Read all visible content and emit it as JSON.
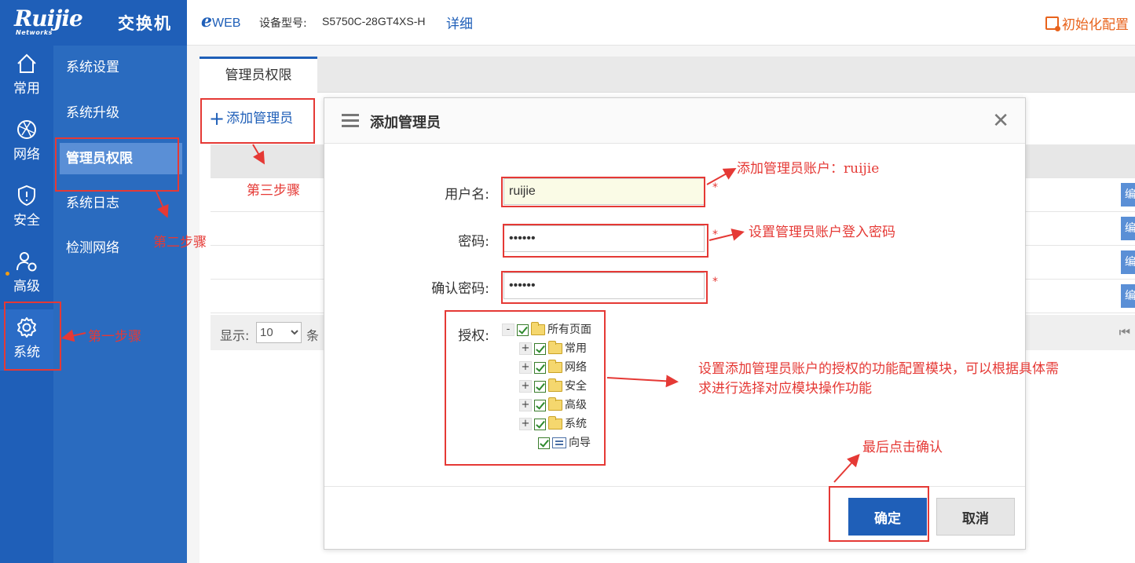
{
  "brand": {
    "logo": "Ruijie",
    "logo_sub": "Networks",
    "product": "交换机"
  },
  "header": {
    "eweb_e": "e",
    "eweb_rest": "WEB",
    "model_label": "设备型号:",
    "model_value": "S5750C-28GT4XS-H",
    "detail_link": "详细",
    "init_config": "初始化配置"
  },
  "rail": {
    "items": [
      {
        "label": "常用",
        "icon": "home-icon"
      },
      {
        "label": "网络",
        "icon": "network-globe-icon"
      },
      {
        "label": "安全",
        "icon": "shield-icon"
      },
      {
        "label": "高级",
        "icon": "users-gear-icon"
      },
      {
        "label": "系统",
        "icon": "gear-icon"
      }
    ]
  },
  "subnav": {
    "items": [
      {
        "label": "系统设置"
      },
      {
        "label": "系统升级"
      },
      {
        "label": "管理员权限"
      },
      {
        "label": "系统日志"
      },
      {
        "label": "检测网络"
      }
    ]
  },
  "tabs": [
    {
      "label": "管理员权限"
    }
  ],
  "toolbar": {
    "add_admin": "添加管理员"
  },
  "table": {
    "edit_label": "编"
  },
  "pager": {
    "show_label": "显示:",
    "page_size": "10",
    "items_label": "条",
    "first_icon": "first-page-icon"
  },
  "modal": {
    "title": "添加管理员",
    "username_label": "用户名:",
    "username_value": "ruijie",
    "password_label": "密码:",
    "password_value": "••••••",
    "confirm_label": "确认密码:",
    "confirm_value": "••••••",
    "required_mark": "*",
    "auth_label": "授权:",
    "tree": {
      "root": {
        "toggle": "-",
        "label": "所有页面"
      },
      "children": [
        {
          "toggle": "+",
          "label": "常用"
        },
        {
          "toggle": "+",
          "label": "网络"
        },
        {
          "toggle": "+",
          "label": "安全"
        },
        {
          "toggle": "+",
          "label": "高级"
        },
        {
          "toggle": "+",
          "label": "系统"
        },
        {
          "toggle": "",
          "label": "向导"
        }
      ]
    },
    "ok_label": "确定",
    "cancel_label": "取消"
  },
  "annotations": {
    "step1": "第一步骤",
    "step2": "第二步骤",
    "step3": "第三步骤",
    "note_user": "添加管理员账户：ruijie",
    "note_pwd": "设置管理员账户登入密码",
    "note_auth_1": "设置添加管理员账户的授权的功能配置模块，可以根据具体需",
    "note_auth_2": "求进行选择对应模块操作功能",
    "note_confirm": "最后点击确认",
    "color": "#e53935"
  }
}
